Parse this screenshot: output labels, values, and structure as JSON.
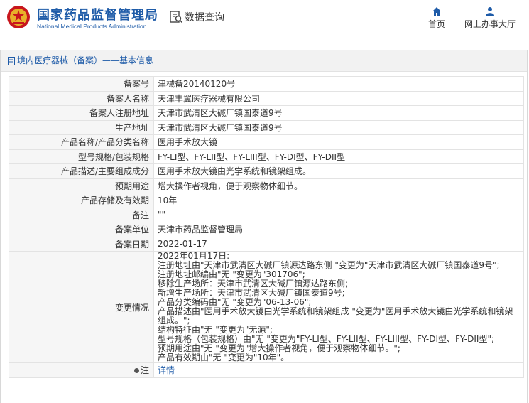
{
  "header": {
    "brand_cn": "国家药品监督管理局",
    "brand_en": "National Medical Products Administration",
    "query_label": "数据查询",
    "nav": [
      {
        "label": "首页",
        "icon": "home-icon"
      },
      {
        "label": "网上办事大厅",
        "icon": "user-icon"
      }
    ],
    "accent_color": "#1e5ba8"
  },
  "panel": {
    "title": "境内医疗器械（备案）——基本信息"
  },
  "fields": [
    {
      "key": "备案号",
      "value": "津械备20140120号"
    },
    {
      "key": "备案人名称",
      "value": "天津丰翼医疗器械有限公司"
    },
    {
      "key": "备案人注册地址",
      "value": "天津市武清区大碱厂镇国泰道9号"
    },
    {
      "key": "生产地址",
      "value": "天津市武清区大碱厂镇国泰道9号"
    },
    {
      "key": "产品名称/产品分类名称",
      "value": "医用手术放大镜"
    },
    {
      "key": "型号规格/包装规格",
      "value": "FY-LI型、FY-LII型、FY-LIII型、FY-DI型、FY-DII型"
    },
    {
      "key": "产品描述/主要组成成分",
      "value": "医用手术放大镜由光学系统和镜架组成。"
    },
    {
      "key": "预期用途",
      "value": "增大操作者视角，便于观察物体细节。"
    },
    {
      "key": "产品存储及有效期",
      "value": "10年"
    },
    {
      "key": "备注",
      "value": "\"\""
    },
    {
      "key": "备案单位",
      "value": "天津市药品监督管理局"
    },
    {
      "key": "备案日期",
      "value": "2022-01-17"
    }
  ],
  "change": {
    "key": "变更情况",
    "lines": [
      "2022年01月17日:",
      "注册地址由\"天津市武清区大碱厂镇源达路东侧 \"变更为\"天津市武清区大碱厂镇国泰道9号\";",
      "注册地址邮编由\"无 \"变更为\"301706\";",
      "移除生产场所：天津市武清区大碱厂镇源达路东侧;",
      "新增生产场所：天津市武清区大碱厂镇国泰道9号;",
      "产品分类编码由\"无 \"变更为\"06-13-06\";",
      "产品描述由\"医用手术放大镜由光学系统和镜架组成 \"变更为\"医用手术放大镜由光学系统和镜架组成。\";",
      "结构特征由\"无 \"变更为\"无源\";",
      "型号规格（包装规格）由\"无 \"变更为\"FY-LI型、FY-LII型、FY-LIII型、FY-DI型、FY-DII型\";",
      "预期用途由\"无 \"变更为\"增大操作者视角，便于观察物体细节。\";",
      "产品有效期由\"无 \"变更为\"10年\"。"
    ]
  },
  "note": {
    "key": "注",
    "link": "详情"
  }
}
